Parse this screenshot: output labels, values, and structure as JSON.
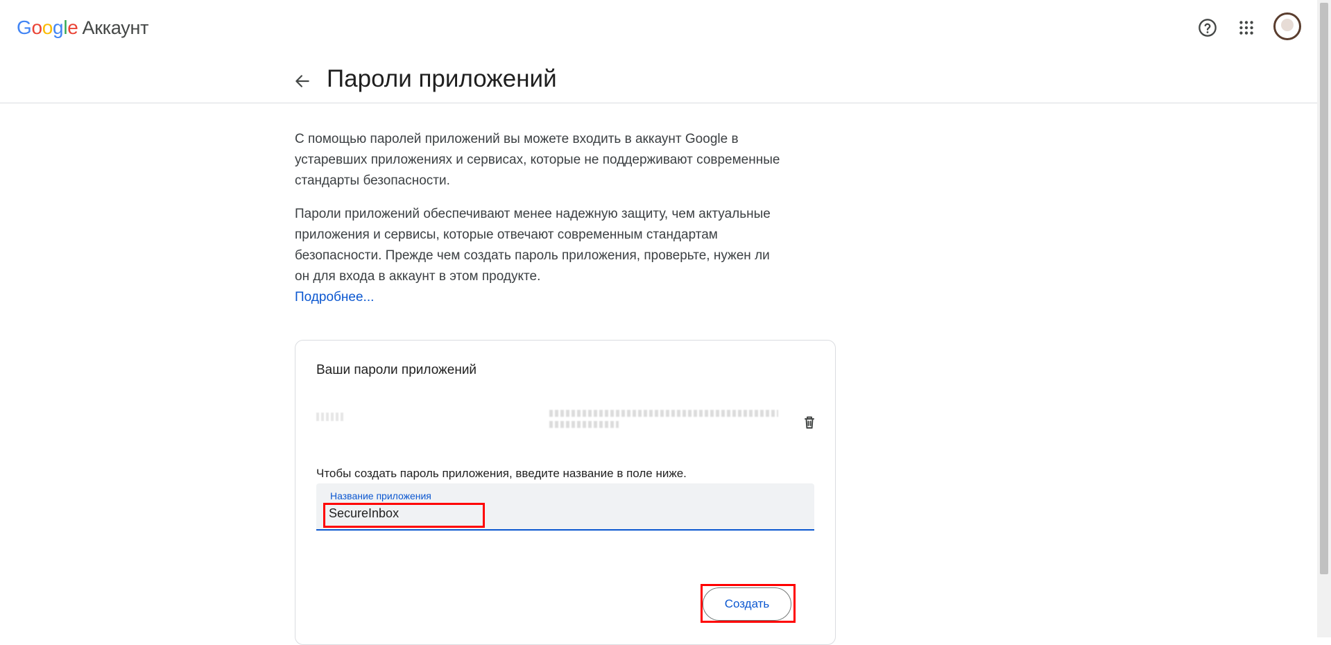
{
  "header": {
    "logo_letters": [
      "G",
      "o",
      "o",
      "g",
      "l",
      "e"
    ],
    "product_name": "Аккаунт",
    "help_icon": "help-circle-icon",
    "apps_icon": "apps-grid-icon",
    "avatar_icon": "user-avatar"
  },
  "page": {
    "back_icon": "arrow-back-icon",
    "title": "Пароли приложений"
  },
  "content": {
    "paragraph1": "С помощью паролей приложений вы можете входить в аккаунт Google в устаревших приложениях и сервисах, которые не поддерживают современные стандарты безопасности.",
    "paragraph2": "Пароли приложений обеспечивают менее надежную защиту, чем актуальные приложения и сервисы, которые отвечают современным стандартам безопасности. Прежде чем создать пароль приложения, проверьте, нужен ли он для входа в аккаунт в этом продукте.",
    "learn_more": "Подробнее..."
  },
  "card": {
    "title": "Ваши пароли приложений",
    "passwords": [
      {
        "name_hidden": true,
        "date_hidden": true,
        "delete_icon": "trash-icon"
      }
    ],
    "hint": "Чтобы создать пароль приложения, введите название в поле ниже.",
    "field_label": "Название приложения",
    "field_value": "SecureInbox",
    "create_button": "Создать"
  },
  "colors": {
    "accent": "#0b57d0",
    "highlight": "#ff0000",
    "text": "#1f1f1f",
    "field_bg": "#f0f2f4"
  }
}
